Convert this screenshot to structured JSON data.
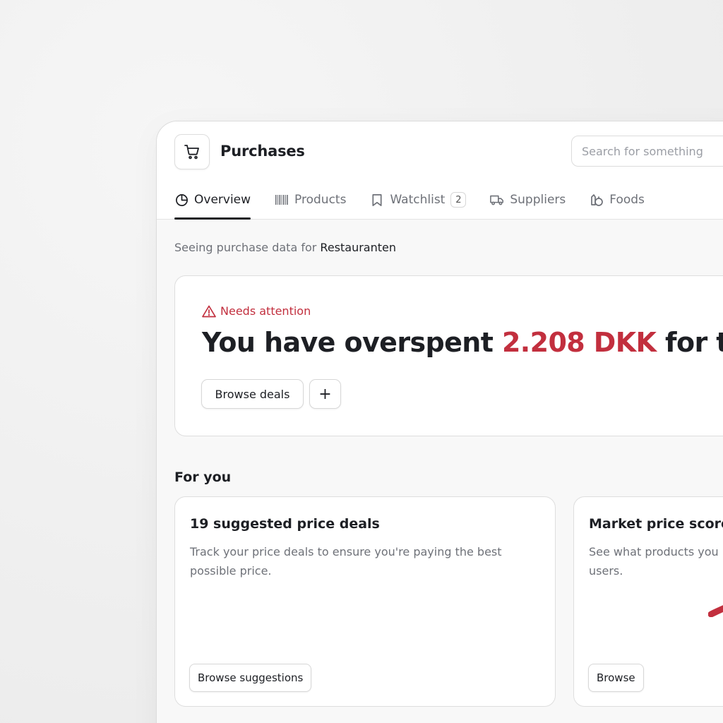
{
  "header": {
    "title": "Purchases",
    "search_placeholder": "Search for something"
  },
  "tabs": [
    {
      "label": "Overview",
      "icon": "pie-chart-icon",
      "active": true
    },
    {
      "label": "Products",
      "icon": "barcode-icon"
    },
    {
      "label": "Watchlist",
      "icon": "bookmark-icon",
      "badge": "2"
    },
    {
      "label": "Suppliers",
      "icon": "truck-icon"
    },
    {
      "label": "Foods",
      "icon": "food-icon"
    }
  ],
  "context": {
    "prefix": "Seeing purchase data for",
    "value": "Restauranten"
  },
  "alert": {
    "label": "Needs attention",
    "headline_start": "You have overspent",
    "amount": "2.208 DKK",
    "headline_end": "for this p",
    "browse_deals_label": "Browse deals",
    "add_label": "+"
  },
  "section": {
    "title": "For you"
  },
  "cards": [
    {
      "title": "19 suggested price deals",
      "description": "Track your price deals to ensure you're paying the best possible price.",
      "button": "Browse suggestions"
    },
    {
      "title": "Market price score",
      "description": "See what products you pay more for compared to other users.",
      "button": "Browse"
    }
  ],
  "colors": {
    "accent": "#c22f3e",
    "text": "#1d1f24",
    "muted": "#6e7178"
  }
}
